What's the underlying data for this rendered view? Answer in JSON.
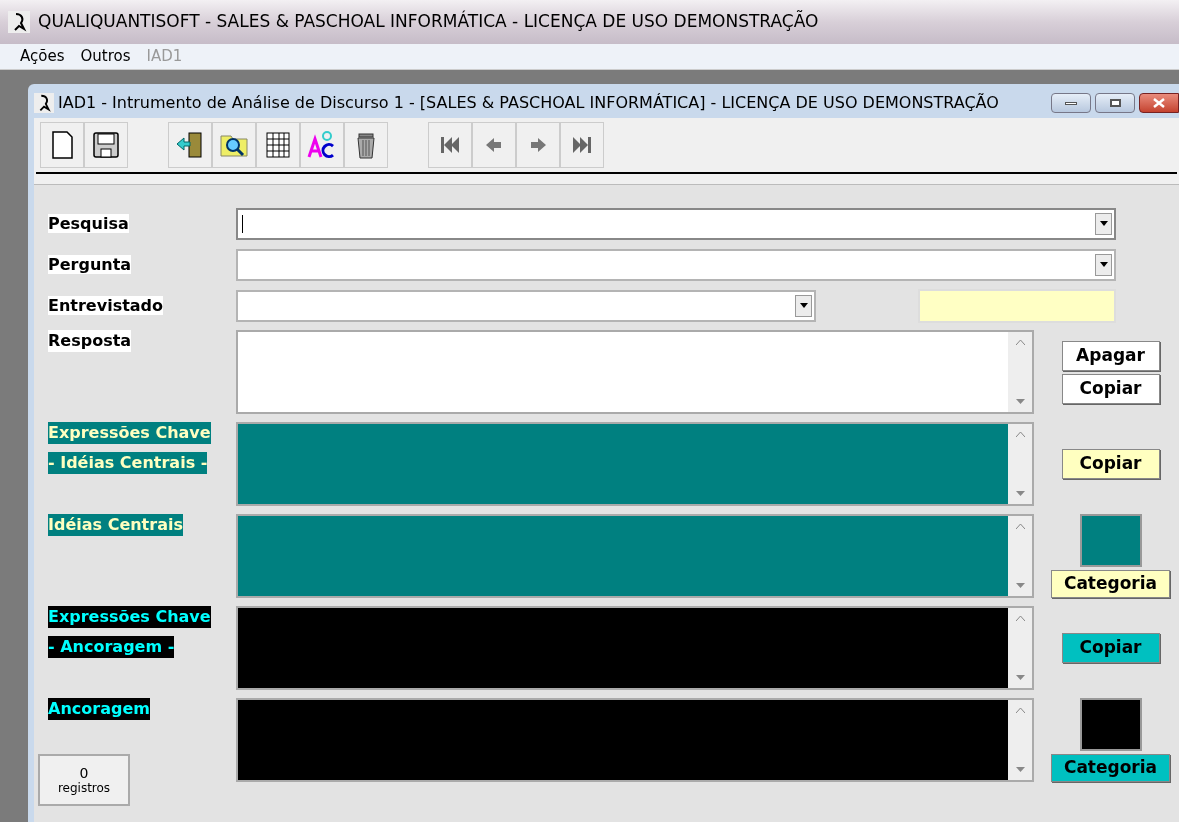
{
  "app_title": "QUALIQUANTISOFT - SALES & PASCHOAL INFORMÁTICA - LICENÇA DE USO DEMONSTRAÇÃO",
  "menu": [
    {
      "label": "Ações",
      "disabled": false
    },
    {
      "label": "Outros",
      "disabled": false
    },
    {
      "label": "IAD1",
      "disabled": true
    }
  ],
  "window": {
    "title": "IAD1 - Intrumento de Análise de Discurso 1  -  [SALES & PASCHOAL INFORMÁTICA]  - LICENÇA DE USO DEMONSTRAÇÃO"
  },
  "toolbar": [
    {
      "kind": "new"
    },
    {
      "kind": "save"
    },
    {
      "kind": "blank"
    },
    {
      "kind": "exit"
    },
    {
      "kind": "search"
    },
    {
      "kind": "grid"
    },
    {
      "kind": "spell"
    },
    {
      "kind": "trash"
    },
    {
      "kind": "blank"
    },
    {
      "kind": "first"
    },
    {
      "kind": "prev"
    },
    {
      "kind": "next"
    },
    {
      "kind": "last"
    }
  ],
  "combos": [
    {
      "label": "Pesquisa",
      "extra": false,
      "focused": true
    },
    {
      "label": "Pergunta",
      "extra": false,
      "focused": false
    },
    {
      "label": "Entrevistado",
      "extra": true,
      "focused": false
    }
  ],
  "text_areas": [
    {
      "labels": [
        "Resposta"
      ],
      "color": "#ffffff",
      "buttons": [
        {
          "kind": "button",
          "label": "Apagar",
          "color": "#ffffff"
        },
        {
          "kind": "button",
          "label": "Copiar",
          "color": "#ffffff"
        }
      ]
    },
    {
      "labels": [
        "Expressões Chave",
        "- Idéias Centrais -"
      ],
      "color": "#008080",
      "buttons": [
        {
          "kind": "button",
          "label": "Copiar",
          "color": "#ffffc0"
        }
      ]
    },
    {
      "labels": [
        "Idéias Centrais"
      ],
      "color": "#008080",
      "buttons": [
        {
          "kind": "swatch",
          "color": "#008080"
        },
        {
          "kind": "button",
          "label": "Categoria",
          "color": "#ffffc0"
        }
      ]
    },
    {
      "labels": [
        "Expressões Chave",
        "- Ancoragem -"
      ],
      "color": "#000000",
      "buttons": [
        {
          "kind": "button",
          "label": "Copiar",
          "color": "#00c0c0"
        }
      ]
    },
    {
      "labels": [
        "Ancoragem"
      ],
      "color": "#000000",
      "buttons": [
        {
          "kind": "swatch",
          "color": "#000000"
        },
        {
          "kind": "button",
          "label": "Categoria",
          "color": "#00c0c0"
        }
      ]
    }
  ],
  "record_count": {
    "count": "0",
    "label": "registros"
  }
}
